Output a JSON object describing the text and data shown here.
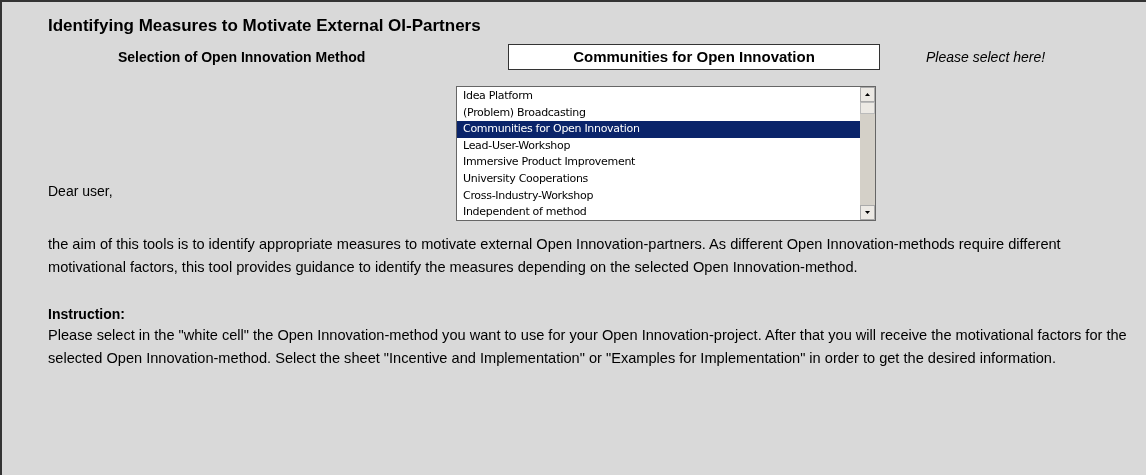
{
  "title": "Identifying Measures to Motivate External OI-Partners",
  "selection": {
    "label": "Selection of Open Innovation Method",
    "value": "Communities for Open Innovation",
    "hint": "Please select here!"
  },
  "dropdown": {
    "options": [
      {
        "label": "Idea Platform",
        "selected": false
      },
      {
        "label": "(Problem) Broadcasting",
        "selected": false
      },
      {
        "label": "Communities for Open Innovation",
        "selected": true
      },
      {
        "label": "Lead-User-Workshop",
        "selected": false
      },
      {
        "label": "Immersive Product Improvement",
        "selected": false
      },
      {
        "label": "University Cooperations",
        "selected": false
      },
      {
        "label": "Cross-Industry-Workshop",
        "selected": false
      },
      {
        "label": "Independent of method",
        "selected": false
      }
    ]
  },
  "greeting": "Dear user,",
  "intro": "the aim of this tools is to identify appropriate measures to motivate external Open Innovation-partners. As different Open Innovation-methods require different motivational factors, this tool provides guidance to identify the measures depending on the selected Open Innovation-method.",
  "instruction_heading": "Instruction:",
  "instruction": "Please select in the \"white cell\" the Open Innovation-method you want to use for your Open Innovation-project. After that you will receive the motivational factors for the selected Open Innovation-method. Select the sheet \"Incentive and Implementation\" or \"Examples for Implementation\" in order to get the desired information."
}
